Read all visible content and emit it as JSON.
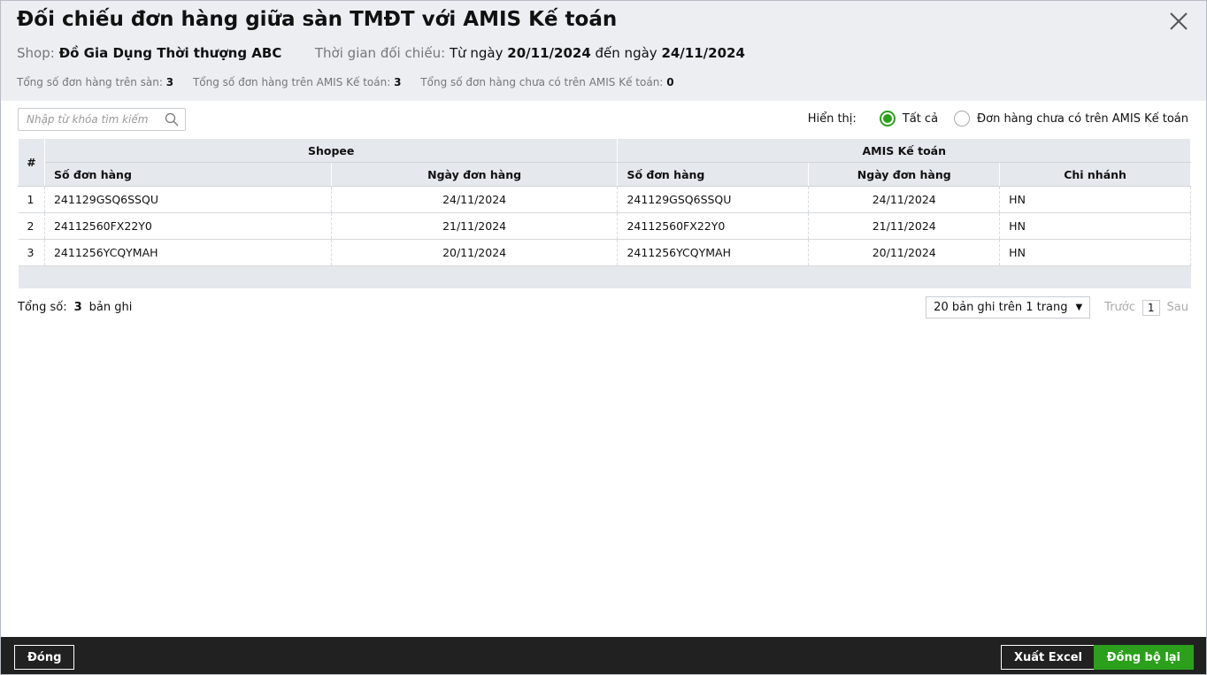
{
  "title": "Đối chiếu đơn hàng giữa sàn TMĐT với AMIS Kế toán",
  "shop_label": "Shop:",
  "shop_name": "Đồ Gia Dụng Thời thượng ABC",
  "period_label": "Thời gian đối chiếu:",
  "from_text": "Từ ngày",
  "from_date": "20/11/2024",
  "to_text": "đến ngày",
  "to_date": "24/11/2024",
  "stats": [
    {
      "label": "Tổng số đơn hàng trên sàn:",
      "value": "3"
    },
    {
      "label": "Tổng số đơn hàng trên AMIS Kế toán:",
      "value": "3"
    },
    {
      "label": "Tổng số đơn hàng chưa có trên AMIS Kế toán:",
      "value": "0"
    }
  ],
  "search": {
    "placeholder": "Nhập từ khóa tìm kiếm"
  },
  "filter": {
    "label": "Hiển thị:",
    "options": [
      "Tất cả",
      "Đơn hàng chưa có trên AMIS Kế toán"
    ],
    "selected": 0
  },
  "table": {
    "index_header": "#",
    "group_shopee": "Shopee",
    "group_amis": "AMIS Kế toán",
    "columns": [
      "Số đơn hàng",
      "Ngày đơn hàng",
      "Số đơn hàng",
      "Ngày đơn hàng",
      "Chi nhánh"
    ],
    "rows": [
      [
        "1",
        "241129GSQ6SSQU",
        "24/11/2024",
        "241129GSQ6SSQU",
        "24/11/2024",
        "HN"
      ],
      [
        "2",
        "24112560FX22Y0",
        "21/11/2024",
        "24112560FX22Y0",
        "21/11/2024",
        "HN"
      ],
      [
        "3",
        "2411256YCQYMAH",
        "20/11/2024",
        "2411256YCQYMAH",
        "20/11/2024",
        "HN"
      ]
    ]
  },
  "total": {
    "label": "Tổng số:",
    "value": "3",
    "unit": "bản ghi"
  },
  "pager": {
    "page_size": "20 bản ghi trên 1 trang",
    "prev": "Trước",
    "page": "1",
    "next": "Sau"
  },
  "buttons": {
    "close": "Đóng",
    "export": "Xuất Excel",
    "sync": "Đồng bộ lại"
  }
}
